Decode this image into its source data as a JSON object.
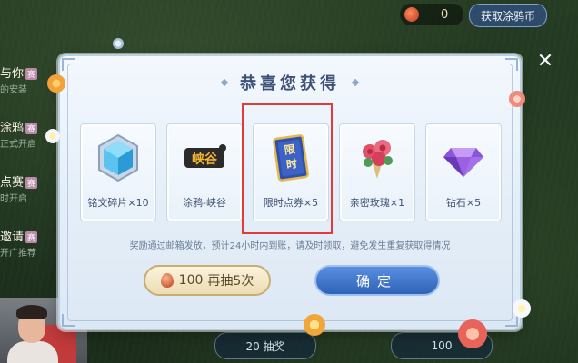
{
  "hud": {
    "coin_count": "0",
    "get_coin_label": "获取涂鸦币"
  },
  "chat": [
    {
      "title": "与你",
      "tag": "赛",
      "sub": "的安装"
    },
    {
      "title": "涂鸦",
      "tag": "赛",
      "sub": "正式开启"
    },
    {
      "title": "点赛",
      "tag": "赛",
      "sub": "时开启"
    },
    {
      "title": "邀请",
      "tag": "赛",
      "sub": "开广推荐"
    }
  ],
  "dialog": {
    "title": "恭喜您获得",
    "rewards": [
      {
        "icon": "inscription-shard-icon",
        "label": "铭文碎片×10"
      },
      {
        "icon": "graffiti-xiagu-icon",
        "label": "涂鸦-峡谷",
        "icon_text": "峡谷"
      },
      {
        "icon": "limited-voucher-icon",
        "label": "限时点券×5",
        "icon_text": "限时"
      },
      {
        "icon": "rose-bouquet-icon",
        "label": "亲密玫瑰×1"
      },
      {
        "icon": "diamond-icon",
        "label": "钻石×5"
      }
    ],
    "notice": "奖励通过邮箱发放，预计24小时内到账，请及时领取，避免发生重复获取得情况",
    "draw_button": {
      "cost": "100",
      "label": "再抽5次"
    },
    "confirm_button": "确定"
  },
  "bottom": {
    "left_label": "20 抽奖",
    "right_label": "100"
  },
  "colors": {
    "highlight": "#e33a3a",
    "title": "#3e5177",
    "confirm": "#2f63b8"
  }
}
